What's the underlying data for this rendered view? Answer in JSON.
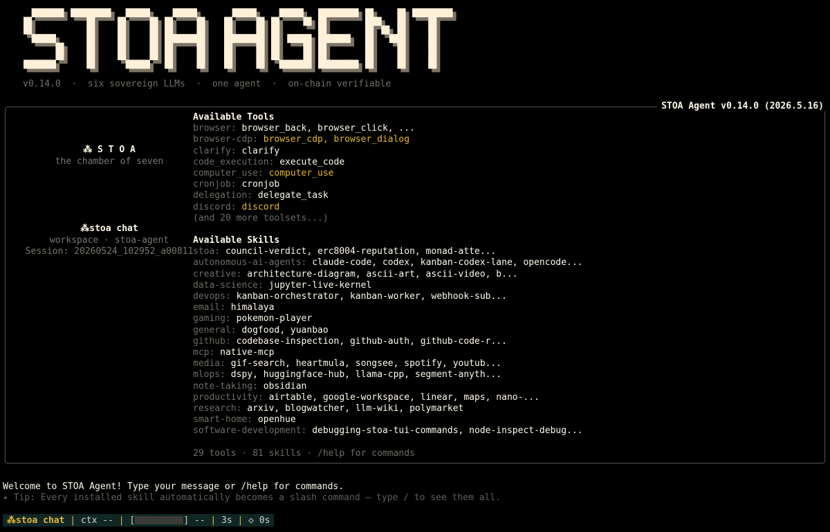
{
  "banner": {
    "title": "STOA AGENT",
    "tagline": "v0.14.0  ·  six sovereign LLMs  ·  one agent  ·  on-chain verifiable"
  },
  "panel": {
    "title": "STOA Agent v0.14.0 (2026.5.16)",
    "left": {
      "logo": "⁂ S T O A",
      "subtitle": "the chamber of seven",
      "chat_label": "⁂stoa chat",
      "workspace": "workspace · stoa-agent",
      "session": "Session: 20260524_102952_a00811"
    },
    "tools": {
      "heading": "Available Tools",
      "rows": [
        {
          "cat": "browser:",
          "val": "browser_back, browser_click, ...",
          "gold": false
        },
        {
          "cat": "browser-cdp:",
          "val": "browser_cdp, browser_dialog",
          "gold": true
        },
        {
          "cat": "clarify:",
          "val": "clarify",
          "gold": false
        },
        {
          "cat": "code_execution:",
          "val": "execute_code",
          "gold": false
        },
        {
          "cat": "computer_use:",
          "val": "computer_use",
          "gold": true
        },
        {
          "cat": "cronjob:",
          "val": "cronjob",
          "gold": false
        },
        {
          "cat": "delegation:",
          "val": "delegate_task",
          "gold": false
        },
        {
          "cat": "discord:",
          "val": "discord",
          "gold": true
        }
      ],
      "more": "(and 20 more toolsets...)"
    },
    "skills": {
      "heading": "Available Skills",
      "rows": [
        {
          "cat": "stoa:",
          "val": "council-verdict, erc8004-reputation, monad-atte..."
        },
        {
          "cat": "autonomous-ai-agents:",
          "val": "claude-code, codex, kanban-codex-lane, opencode..."
        },
        {
          "cat": "creative:",
          "val": "architecture-diagram, ascii-art, ascii-video, b..."
        },
        {
          "cat": "data-science:",
          "val": "jupyter-live-kernel"
        },
        {
          "cat": "devops:",
          "val": "kanban-orchestrator, kanban-worker, webhook-sub..."
        },
        {
          "cat": "email:",
          "val": "himalaya"
        },
        {
          "cat": "gaming:",
          "val": "pokemon-player"
        },
        {
          "cat": "general:",
          "val": "dogfood, yuanbao"
        },
        {
          "cat": "github:",
          "val": "codebase-inspection, github-auth, github-code-r..."
        },
        {
          "cat": "mcp:",
          "val": "native-mcp"
        },
        {
          "cat": "media:",
          "val": "gif-search, heartmula, songsee, spotify, youtub..."
        },
        {
          "cat": "mlops:",
          "val": "dspy, huggingface-hub, llama-cpp, segment-anyth..."
        },
        {
          "cat": "note-taking:",
          "val": "obsidian"
        },
        {
          "cat": "productivity:",
          "val": "airtable, google-workspace, linear, maps, nano-..."
        },
        {
          "cat": "research:",
          "val": "arxiv, blogwatcher, llm-wiki, polymarket"
        },
        {
          "cat": "smart-home:",
          "val": "openhue"
        },
        {
          "cat": "software-development:",
          "val": "debugging-stoa-tui-commands, node-inspect-debug..."
        }
      ]
    },
    "footer": "29 tools · 81 skills · /help for commands"
  },
  "welcome": "Welcome to STOA Agent! Type your message or /help for commands.",
  "tip": "✦ Tip: Every installed skill automatically becomes a slash command — type / to see them all.",
  "status": {
    "chat": "⁂stoa chat",
    "ctx": "ctx --",
    "bar_open": "[",
    "bar_close": "] --",
    "time": "3s",
    "diamond": "◇ 0s",
    "sep": "|"
  },
  "colors": {
    "background": "#000000",
    "text": "#fffbea",
    "accent_gold": "#e6b82e",
    "muted": "#6d6d66",
    "status_bg": "#0f2624"
  }
}
